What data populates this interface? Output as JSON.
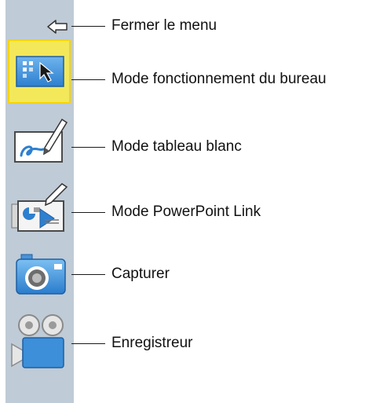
{
  "labels": {
    "close": "Fermer le menu",
    "desktop": "Mode fonctionnement du bureau",
    "whiteboard": "Mode tableau blanc",
    "powerpoint": "Mode PowerPoint Link",
    "capture": "Capturer",
    "recorder": "Enregistreur"
  },
  "colors": {
    "sidebar_bg": "#bfcbd6",
    "highlight": "#f3e85a",
    "icon_blue": "#3c8fd8"
  },
  "icons": {
    "close": "arrow-left-icon",
    "desktop": "desktop-pointer-icon",
    "whiteboard": "whiteboard-pen-icon",
    "powerpoint": "powerpoint-link-icon",
    "capture": "camera-icon",
    "recorder": "video-recorder-icon"
  }
}
